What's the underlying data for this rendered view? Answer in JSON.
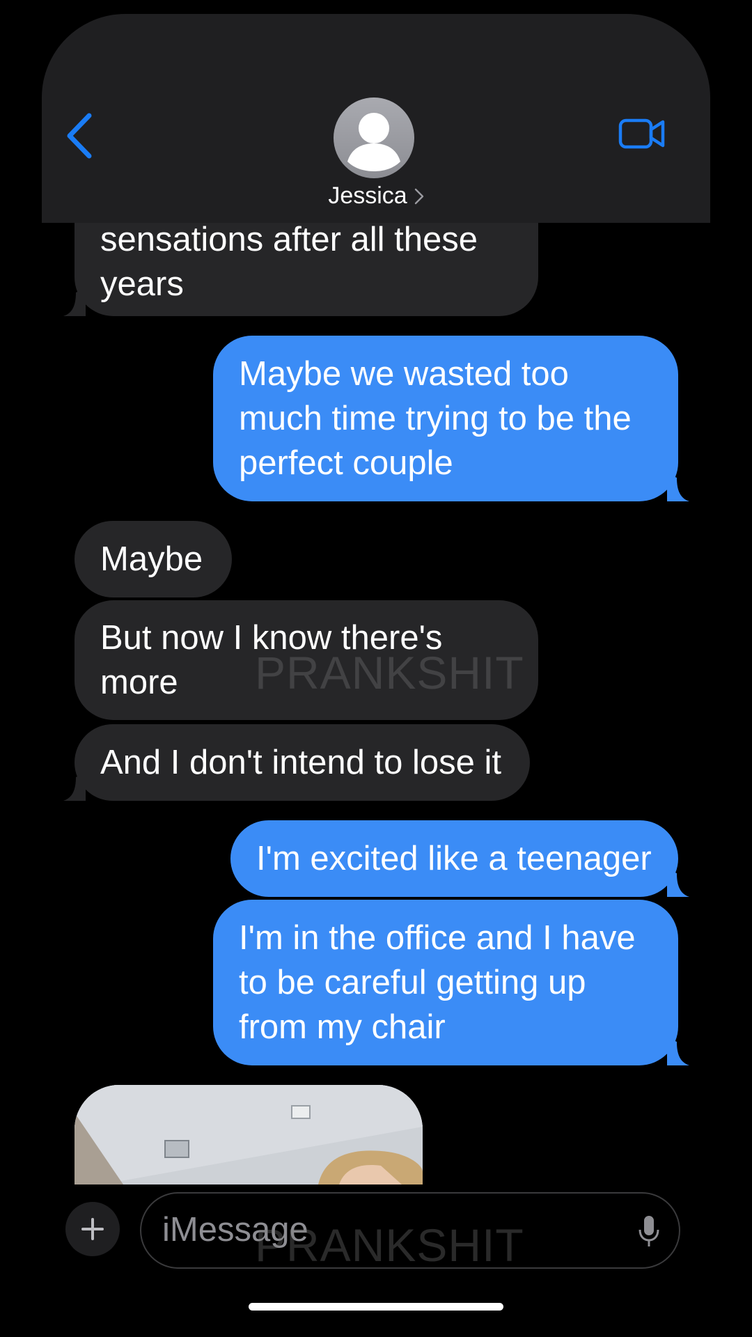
{
  "header": {
    "contact_name": "Jessica",
    "icons": {
      "back": "chevron-left-icon",
      "video": "video-camera-icon",
      "avatar": "person-avatar-icon",
      "contact_chevron": "chevron-right-icon"
    }
  },
  "messages": [
    {
      "side": "incoming",
      "lines": [
        "sensations after all these",
        "years"
      ]
    },
    {
      "side": "outgoing",
      "lines": [
        "Maybe we wasted too",
        "much time trying to be the",
        "perfect couple"
      ]
    },
    {
      "side": "incoming",
      "lines": [
        "Maybe"
      ]
    },
    {
      "side": "incoming",
      "lines": [
        "But now I know there's",
        "more"
      ]
    },
    {
      "side": "incoming",
      "lines": [
        "And I don't intend to lose it"
      ]
    },
    {
      "side": "outgoing",
      "lines": [
        "I'm excited like a teenager"
      ]
    },
    {
      "side": "outgoing",
      "lines": [
        "I'm in the office and I have",
        "to be careful getting up",
        "from my chair"
      ]
    }
  ],
  "watermark": "PRANKSHIT",
  "composer": {
    "placeholder": "iMessage",
    "icons": {
      "plus": "plus-icon",
      "mic": "microphone-icon"
    }
  },
  "colors": {
    "outgoing_bubble": "#3b8cf6",
    "incoming_bubble": "#262628",
    "accent": "#1a7cf5",
    "header_bg": "#1f1f21"
  }
}
